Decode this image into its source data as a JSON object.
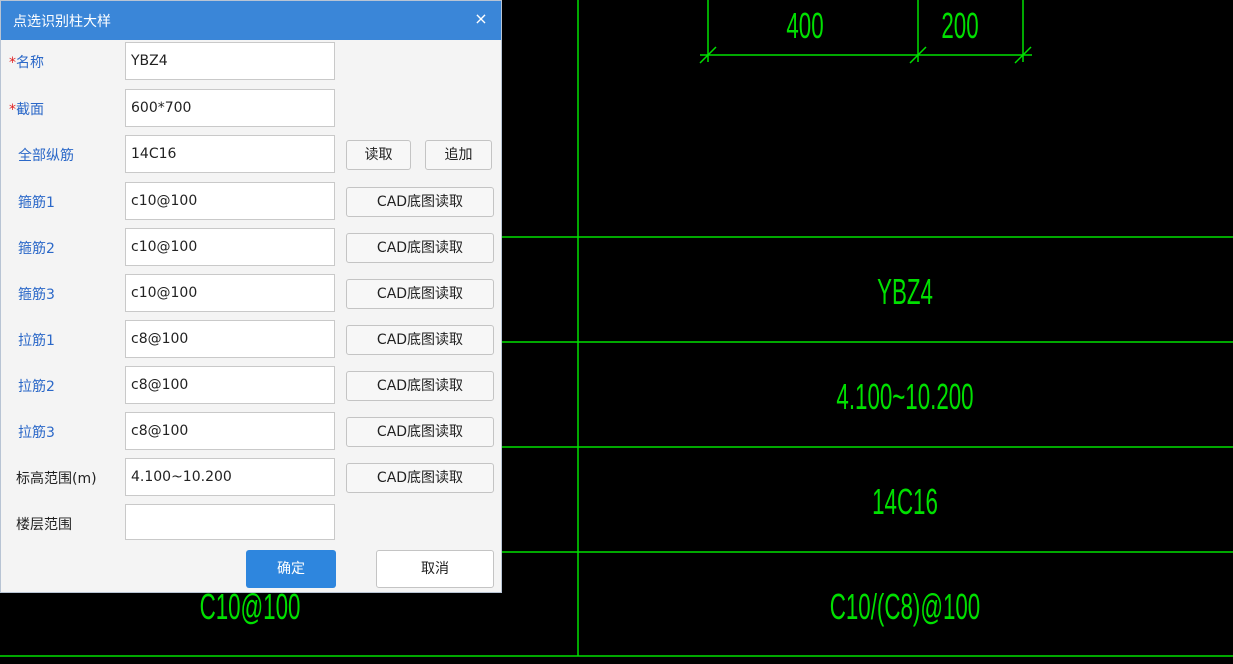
{
  "cad": {
    "dim_left": "400",
    "dim_right": "200",
    "row_name": "YBZ4",
    "row_elevation": "4.100~10.200",
    "row_longbar": "14C16",
    "row_stirrup": "C10/(C8)@100",
    "left_partial": "C10@100",
    "line_color": "#00e000"
  },
  "dialog": {
    "title": "点选识别柱大样",
    "close_icon": "×",
    "accent_color": "#2e86de",
    "rows": [
      {
        "label": "名称",
        "required": true,
        "value": "YBZ4"
      },
      {
        "label": "截面",
        "required": true,
        "value": "600*700"
      },
      {
        "label": "全部纵筋",
        "value": "14C16",
        "btn1": "读取",
        "btn2": "追加"
      },
      {
        "label": "箍筋1",
        "value": "c10@100",
        "btn": "CAD底图读取"
      },
      {
        "label": "箍筋2",
        "value": "c10@100",
        "btn": "CAD底图读取"
      },
      {
        "label": "箍筋3",
        "value": "c10@100",
        "btn": "CAD底图读取"
      },
      {
        "label": "拉筋1",
        "value": "c8@100",
        "btn": "CAD底图读取"
      },
      {
        "label": "拉筋2",
        "value": "c8@100",
        "btn": "CAD底图读取"
      },
      {
        "label": "拉筋3",
        "value": "c8@100",
        "btn": "CAD底图读取"
      },
      {
        "label": "标高范围(m)",
        "value": "4.100~10.200",
        "btn": "CAD底图读取"
      },
      {
        "label": "楼层范围",
        "value": ""
      }
    ],
    "ok_label": "确定",
    "cancel_label": "取消"
  }
}
